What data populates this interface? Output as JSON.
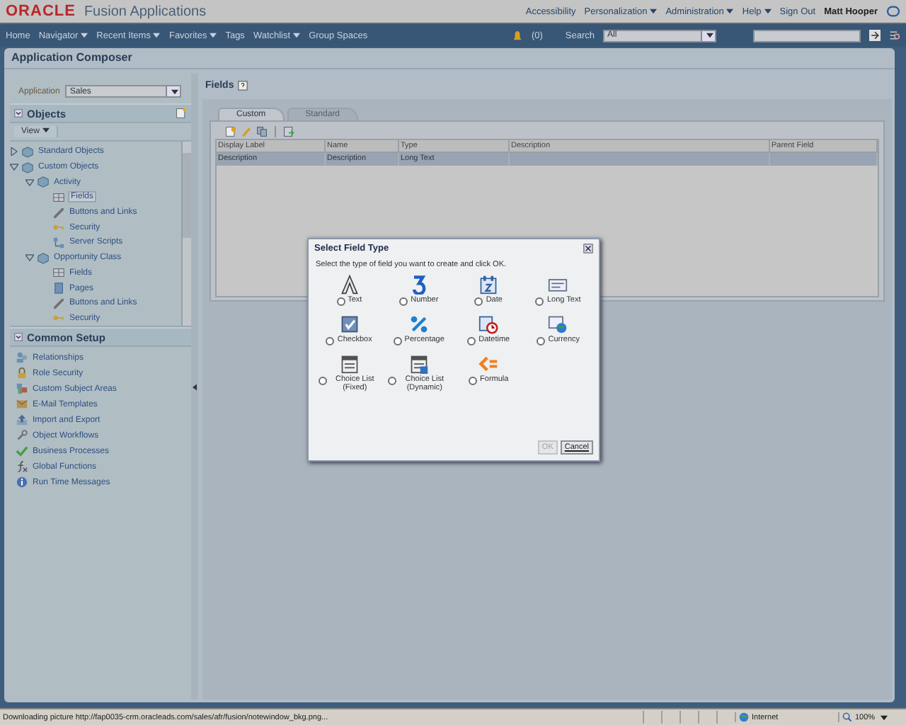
{
  "header": {
    "brand": "ORACLE",
    "product": "Fusion Applications",
    "links": [
      {
        "label": "Accessibility",
        "menu": false
      },
      {
        "label": "Personalization",
        "menu": true
      },
      {
        "label": "Administration",
        "menu": true
      },
      {
        "label": "Help",
        "menu": true
      },
      {
        "label": "Sign Out",
        "menu": false
      }
    ],
    "user": "Matt Hooper"
  },
  "nav": {
    "items": [
      {
        "label": "Home",
        "menu": false
      },
      {
        "label": "Navigator",
        "menu": true
      },
      {
        "label": "Recent Items",
        "menu": true
      },
      {
        "label": "Favorites",
        "menu": true
      },
      {
        "label": "Tags",
        "menu": false
      },
      {
        "label": "Watchlist",
        "menu": true
      },
      {
        "label": "Group Spaces",
        "menu": false
      }
    ],
    "notifications": "(0)",
    "search_label": "Search",
    "search_scope": "All"
  },
  "page_title": "Application Composer",
  "application": {
    "label": "Application",
    "value": "Sales"
  },
  "objects": {
    "title": "Objects",
    "view_button": "View",
    "tree": [
      {
        "label": "Standard Objects",
        "expanded": false,
        "selected": false
      },
      {
        "label": "Custom Objects",
        "expanded": true,
        "selected": false,
        "children": [
          {
            "label": "Activity",
            "expanded": true,
            "selected": false,
            "children": [
              {
                "label": "Fields",
                "selected": true
              },
              {
                "label": "Buttons and Links",
                "selected": false
              },
              {
                "label": "Security",
                "selected": false
              },
              {
                "label": "Server Scripts",
                "selected": false
              }
            ]
          },
          {
            "label": "Opportunity Class",
            "expanded": true,
            "selected": false,
            "children": [
              {
                "label": "Fields",
                "selected": false
              },
              {
                "label": "Pages",
                "selected": false
              },
              {
                "label": "Buttons and Links",
                "selected": false
              },
              {
                "label": "Security",
                "selected": false
              }
            ]
          }
        ]
      }
    ]
  },
  "common_setup": {
    "title": "Common Setup",
    "items": [
      "Relationships",
      "Role Security",
      "Custom Subject Areas",
      "E-Mail Templates",
      "Import and Export",
      "Object Workflows",
      "Business Processes",
      "Global Functions",
      "Run Time Messages"
    ]
  },
  "fields": {
    "title": "Fields",
    "tabs": [
      {
        "label": "Custom",
        "selected": true
      },
      {
        "label": "Standard",
        "selected": false
      }
    ],
    "table": {
      "columns": [
        "Display Label",
        "Name",
        "Type",
        "Description",
        "Parent Field"
      ],
      "rows": [
        {
          "cells": [
            "Description",
            "Description",
            "Long Text",
            "",
            ""
          ],
          "selected": true
        }
      ]
    }
  },
  "dialog": {
    "title": "Select Field Type",
    "instruction": "Select the type of field you want to create and click OK.",
    "options": [
      {
        "label": "Text",
        "selected": false
      },
      {
        "label": "Number",
        "selected": false
      },
      {
        "label": "Date",
        "selected": false
      },
      {
        "label": "Long Text",
        "selected": false
      },
      {
        "label": "Checkbox",
        "selected": false
      },
      {
        "label": "Percentage",
        "selected": false
      },
      {
        "label": "Datetime",
        "selected": false
      },
      {
        "label": "Currency",
        "selected": false
      },
      {
        "label": "Choice List (Fixed)",
        "selected": false
      },
      {
        "label": "Choice List (Dynamic)",
        "selected": false
      },
      {
        "label": "Formula",
        "selected": false
      }
    ],
    "ok": {
      "label": "OK",
      "disabled": true
    },
    "cancel": "Cancel"
  },
  "status_bar": {
    "message": "Downloading picture http://fap0035-crm.oracleads.com/sales/afr/fusion/notewindow_bkg.png...",
    "zone": "Internet",
    "zoom": "100%"
  }
}
